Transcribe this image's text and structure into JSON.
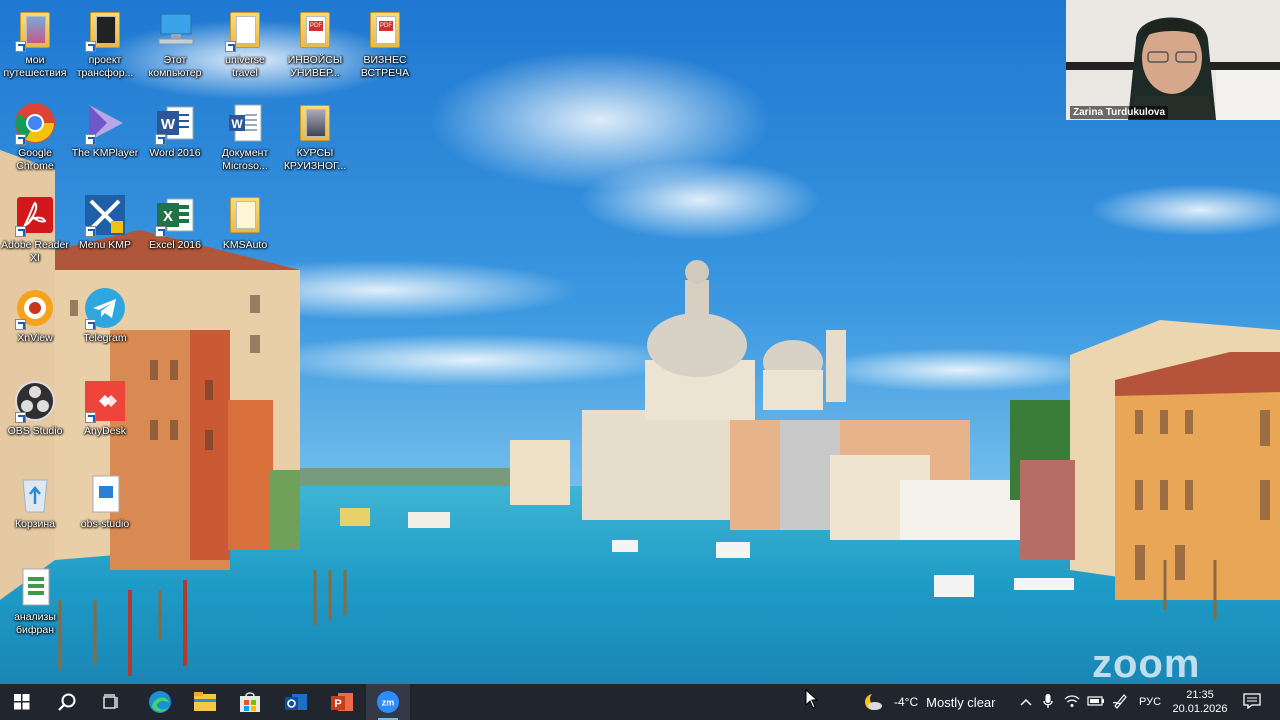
{
  "desktop": {
    "icons": [
      {
        "label": "мои путешествия",
        "icon": "folder-icon"
      },
      {
        "label": "проект трансфор...",
        "icon": "folder-icon"
      },
      {
        "label": "Этот компьютер",
        "icon": "computer-icon"
      },
      {
        "label": "universe travel",
        "icon": "folder-icon"
      },
      {
        "label": "ИНВОЙСЫ УНИВЕР...",
        "icon": "folder-pdf-icon"
      },
      {
        "label": "ВИЗНЕС ВСТРЕЧА",
        "icon": "folder-pdf-icon"
      },
      {
        "label": "Google Chrome",
        "icon": "chrome-icon"
      },
      {
        "label": "The KMPlayer",
        "icon": "kmplayer-icon"
      },
      {
        "label": "Word 2016",
        "icon": "word-icon"
      },
      {
        "label": "Документ Microso...",
        "icon": "word-document-icon"
      },
      {
        "label": "КУРСЫ КРУИЗНОГ...",
        "icon": "folder-icon"
      },
      {
        "label": "Adobe Reader XI",
        "icon": "adobe-reader-icon"
      },
      {
        "label": "Menu KMP",
        "icon": "kmp-menu-icon"
      },
      {
        "label": "Excel 2016",
        "icon": "excel-icon"
      },
      {
        "label": "KMSAuto",
        "icon": "folder-icon"
      },
      {
        "label": "XnView",
        "icon": "xnview-icon"
      },
      {
        "label": "Telegram",
        "icon": "telegram-icon"
      },
      {
        "label": "OBS Studio",
        "icon": "obs-icon"
      },
      {
        "label": "AnyDesk",
        "icon": "anydesk-icon"
      },
      {
        "label": "Корзина",
        "icon": "recycle-bin-icon"
      },
      {
        "label": "obs-studio",
        "icon": "file-icon"
      },
      {
        "label": "анализы бифран",
        "icon": "file-icon"
      }
    ]
  },
  "zoom": {
    "participant_name": "Zarina Turdukulova",
    "watermark": "zoom"
  },
  "taskbar": {
    "pinned": [
      "start-button",
      "search-button",
      "task-view-button",
      "edge-icon",
      "file-explorer-icon",
      "store-icon",
      "outlook-icon",
      "powerpoint-icon",
      "zoom-icon"
    ],
    "active_app": "zoom-icon",
    "weather": {
      "temp": "-4°C",
      "condition": "Mostly clear"
    },
    "language": "РУС",
    "time": "21:35",
    "date": "20.01.2026"
  },
  "colors": {
    "taskbar": "#20252e",
    "sky_top": "#1f78d1",
    "water": "#2aa0c8",
    "accent": "#76b9ed"
  }
}
